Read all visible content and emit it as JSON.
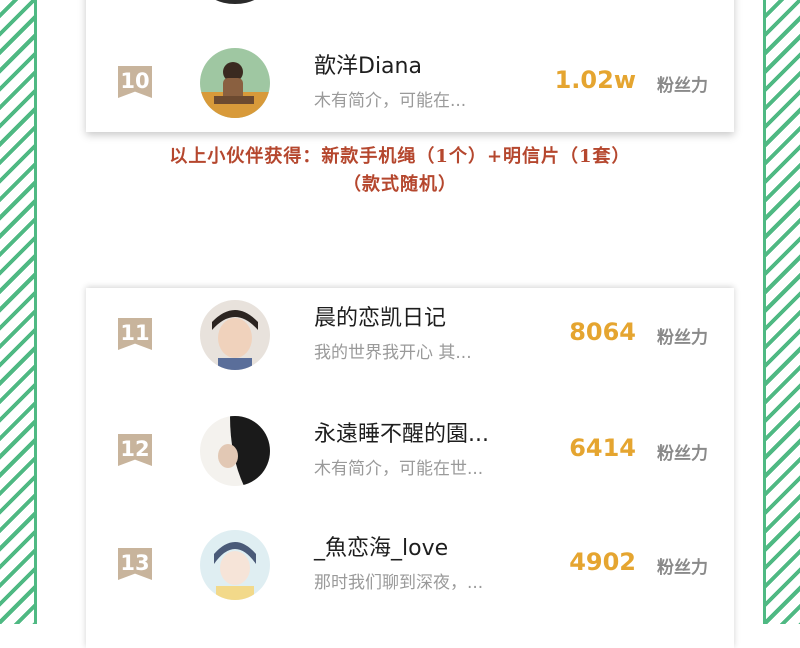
{
  "rows": [
    {
      "rank": "10",
      "name": "歆洋Diana",
      "bio": "木有简介，可能在...",
      "count": "1.02w",
      "unit": "粉丝力"
    },
    {
      "rank": "11",
      "name": "晨的恋凯日记",
      "bio": "我的世界我开心 其...",
      "count": "8064",
      "unit": "粉丝力"
    },
    {
      "rank": "12",
      "name": "永遠睡不醒的園...",
      "bio": "木有简介，可能在世...",
      "count": "6414",
      "unit": "粉丝力"
    },
    {
      "rank": "13",
      "name": "_魚恋海_love",
      "bio": "那时我们聊到深夜，...",
      "count": "4902",
      "unit": "粉丝力"
    }
  ],
  "reward": {
    "line1": "以上小伙伴获得：新款手机绳（1个）+明信片（1套）",
    "line2": "（款式随机）"
  },
  "colors": {
    "accent": "#4fb983",
    "count": "#e5a530",
    "reward": "#b5472e",
    "rank_badge": "#c8b49c"
  }
}
